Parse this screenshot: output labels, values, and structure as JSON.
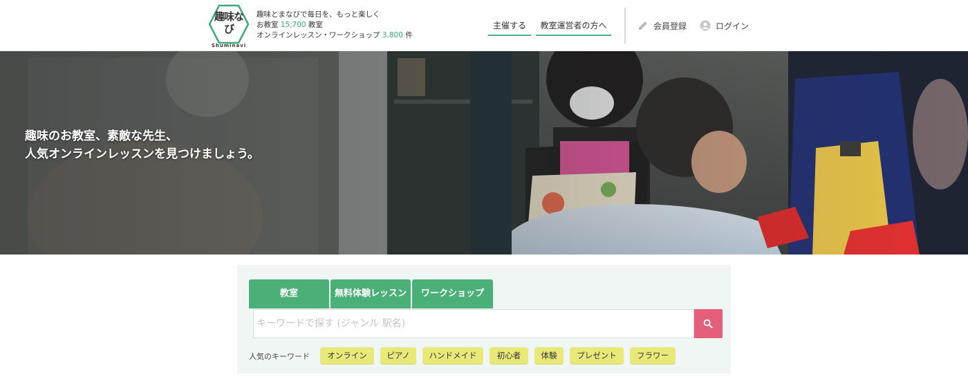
{
  "header": {
    "logo": {
      "mark": "趣味なび",
      "sub": "Shuminavi"
    },
    "tagline": {
      "line1": "趣味とまなびで毎日を、もっと楽しく",
      "line2_prefix": "お教室 ",
      "class_count": "15,700",
      "line2_suffix": " 教室",
      "line3_prefix": "オンラインレッスン・ワークショップ ",
      "workshop_count": "3,800",
      "line3_suffix": " 件"
    },
    "nav": {
      "host": "主催する",
      "owner": "教室運営者の方へ",
      "register": "会員登録",
      "login": "ログイン"
    }
  },
  "hero": {
    "line1": "趣味のお教室、素敵な先生、",
    "line2": "人気オンラインレッスンを見つけましょう。"
  },
  "search": {
    "tabs": [
      "教室",
      "無料体験レッスン",
      "ワークショップ"
    ],
    "placeholder": "キーワードで探す (ジャンル 駅名)",
    "keywords_label": "人気のキーワード",
    "keywords": [
      "オンライン",
      "ピアノ",
      "ハンドメイド",
      "初心者",
      "体験",
      "プレゼント",
      "フラワー"
    ]
  },
  "colors": {
    "brand_green": "#4bb078",
    "search_button": "#e55e7b",
    "keyword_chip": "#e9e97a",
    "panel_bg": "#eff6f3"
  }
}
